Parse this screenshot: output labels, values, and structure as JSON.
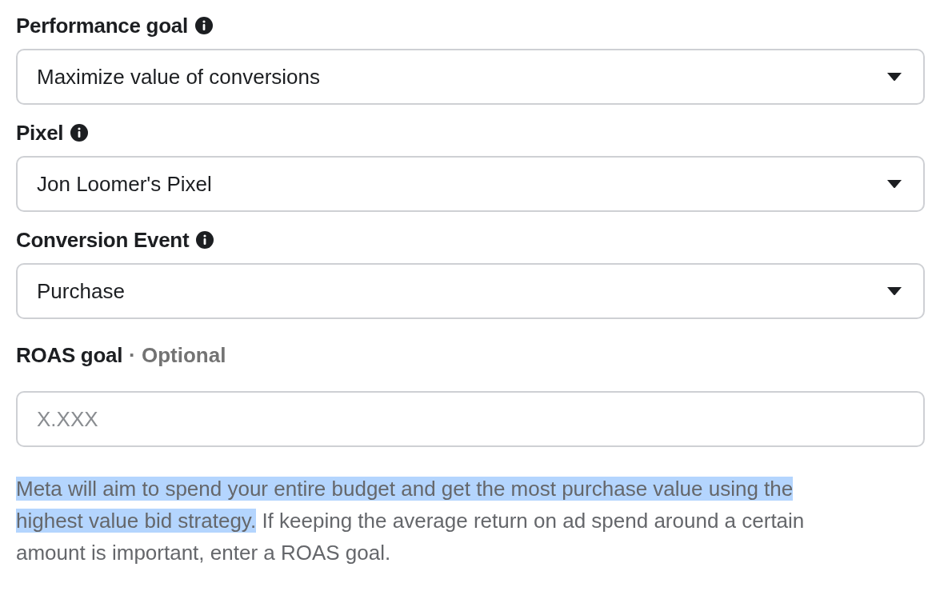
{
  "fields": [
    {
      "label": "Performance goal",
      "info": true,
      "kind": "select",
      "value": "Maximize value of conversions"
    },
    {
      "label": "Pixel",
      "info": true,
      "kind": "select",
      "value": "Jon Loomer's Pixel"
    },
    {
      "label": "Conversion Event",
      "info": true,
      "kind": "select",
      "value": "Purchase"
    },
    {
      "label": "ROAS goal",
      "info": false,
      "optional": "· Optional",
      "kind": "input",
      "placeholder": "X.XXX"
    }
  ],
  "help_text": [
    {
      "text": "Meta will aim to spend your entire budget and get the most purchase value using the highest value bid strategy.",
      "highlighted": true
    },
    {
      "text": " If keeping the average return on ad spend around a certain amount is important, enter a ROAS goal.",
      "highlighted": false
    }
  ]
}
